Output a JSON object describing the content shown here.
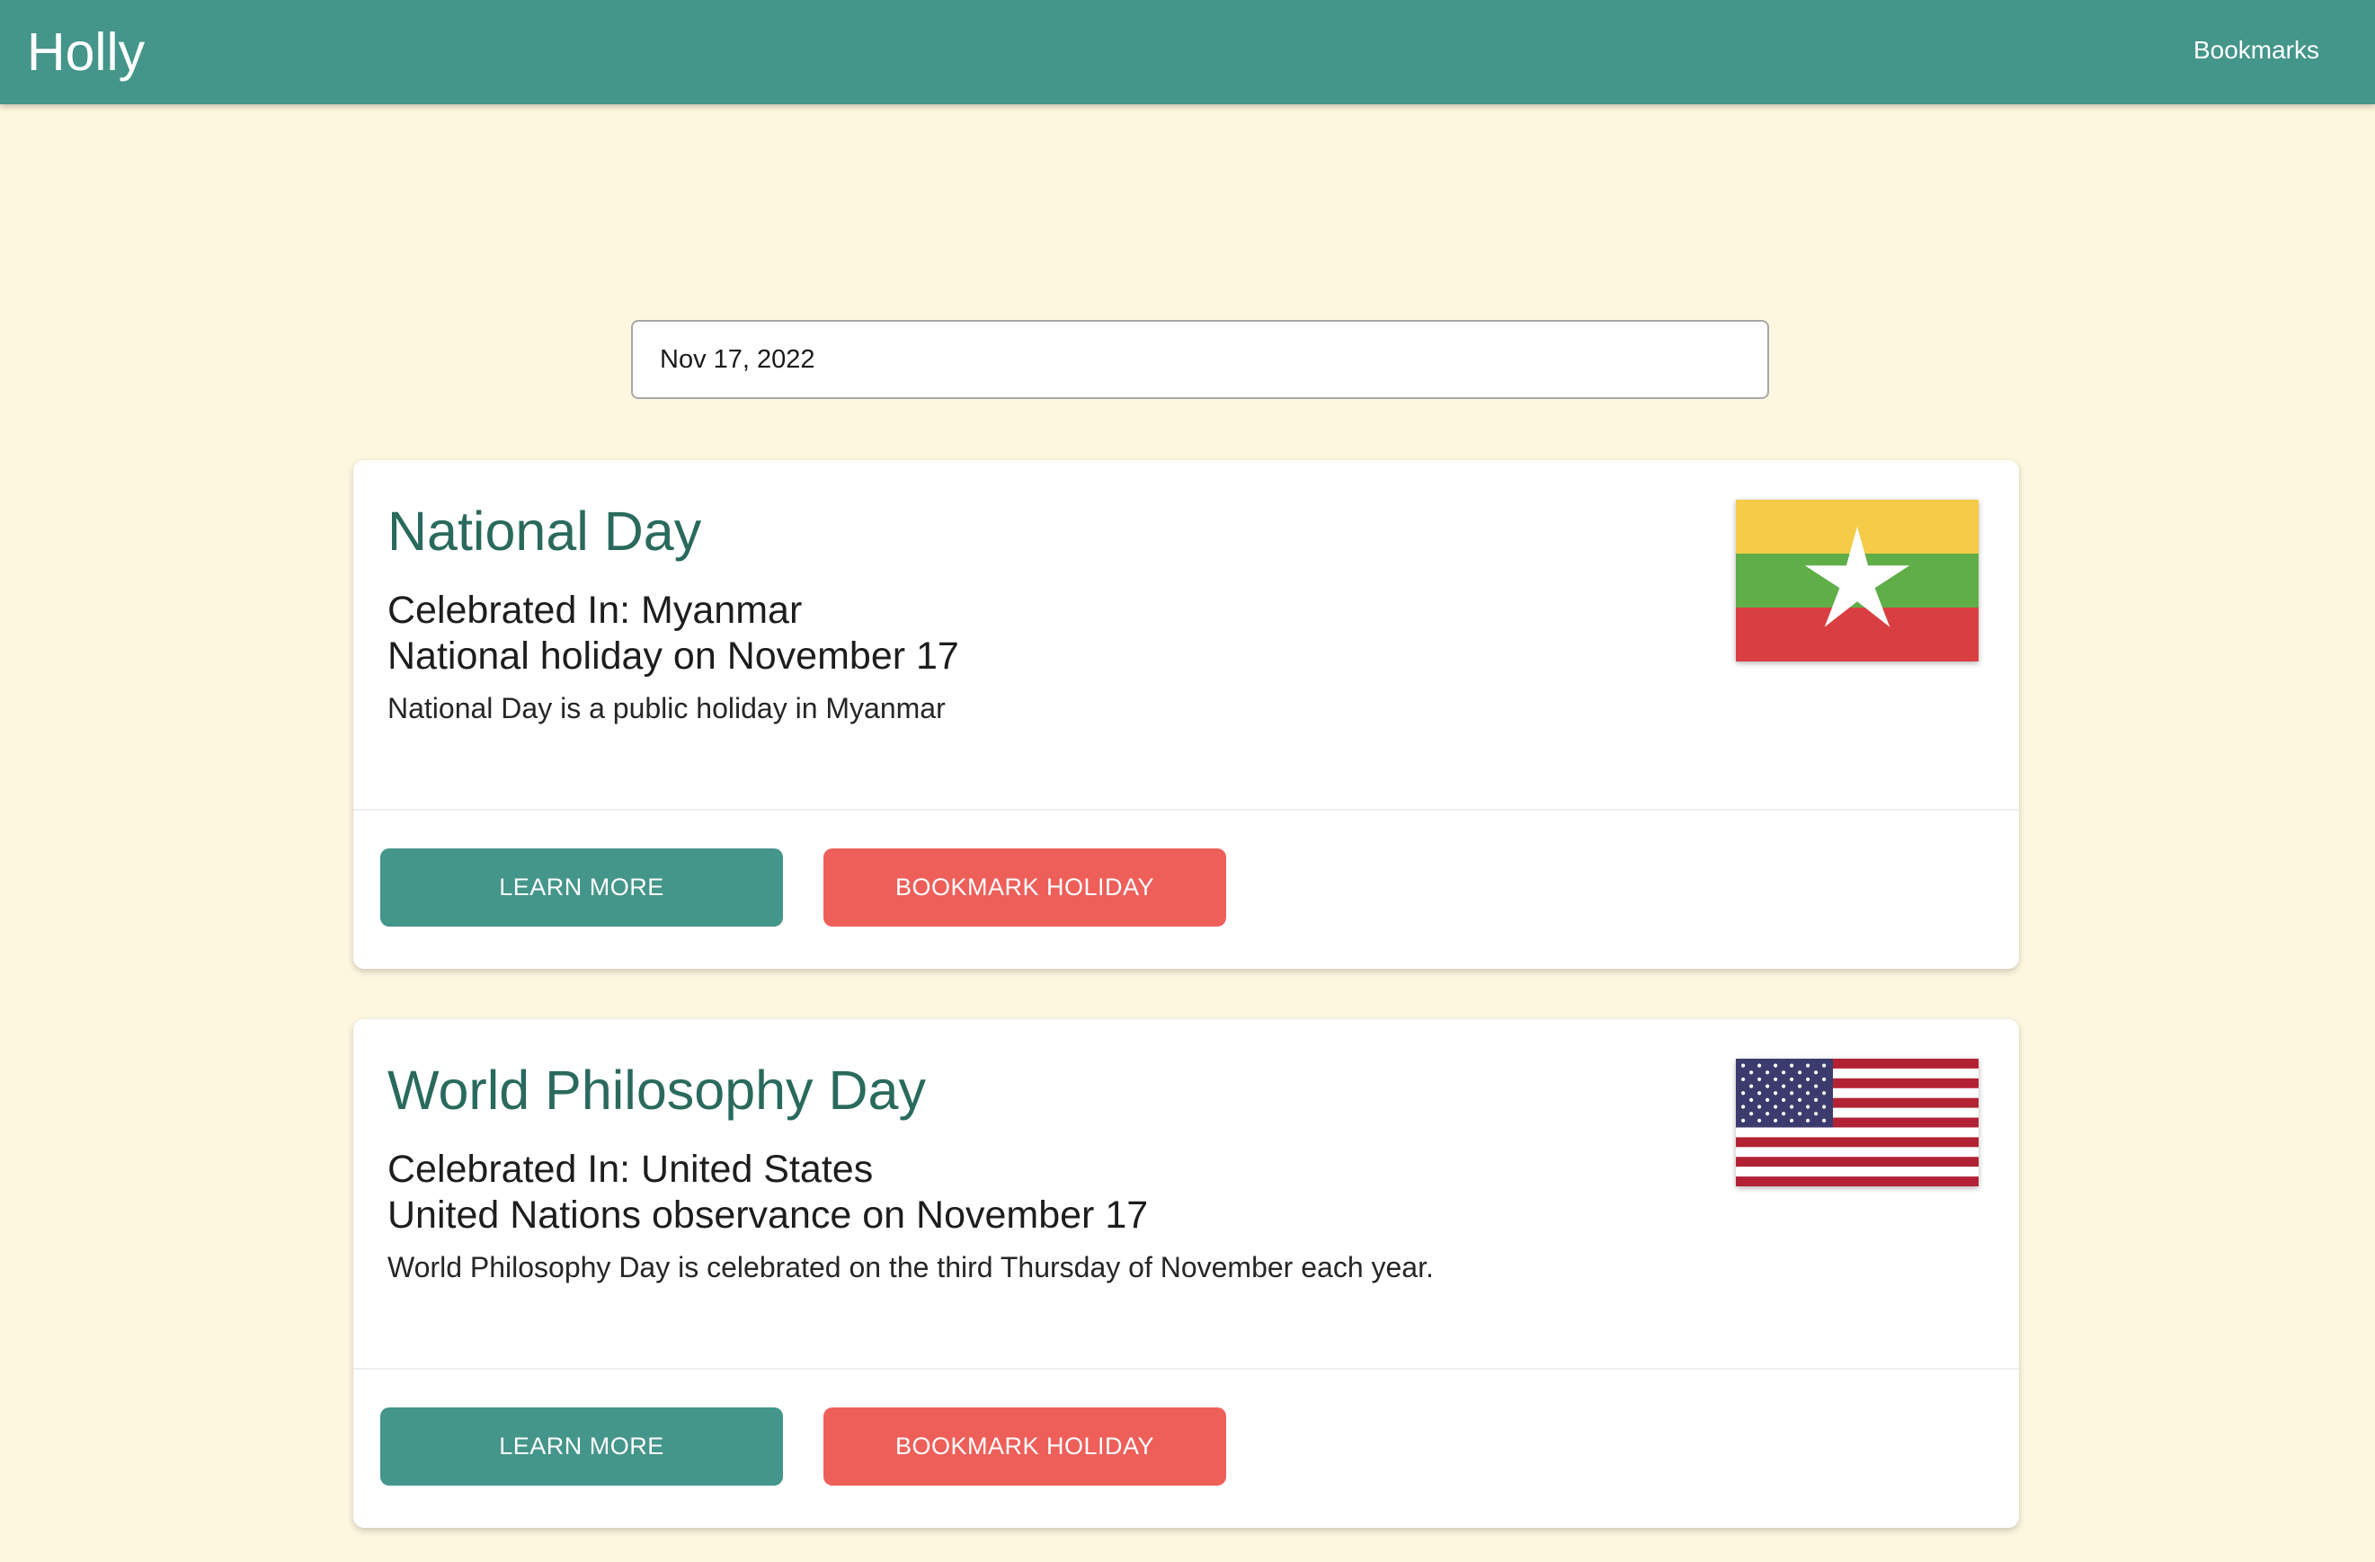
{
  "navbar": {
    "brand": "Holly",
    "bookmarks_link": "Bookmarks"
  },
  "date_picker": {
    "value": "Nov 17, 2022"
  },
  "holidays": [
    {
      "title": "National Day",
      "celebrated_in": "Celebrated In: Myanmar",
      "type_line": "National holiday on November 17",
      "description": "National Day is a public holiday in Myanmar",
      "flag_icon": "myanmar-flag-icon",
      "learn_more_label": "LEARN MORE",
      "bookmark_label": "BOOKMARK HOLIDAY"
    },
    {
      "title": "World Philosophy Day",
      "celebrated_in": "Celebrated In: United States",
      "type_line": "United Nations observance on November 17",
      "description": "World Philosophy Day is celebrated on the third Thursday of November each year.",
      "flag_icon": "united-states-flag-icon",
      "learn_more_label": "LEARN MORE",
      "bookmark_label": "BOOKMARK HOLIDAY"
    }
  ],
  "colors": {
    "page_background": "#fef7e0",
    "navbar": "#44958a",
    "title_text": "#296a5c",
    "learn_more_button": "#44958a",
    "bookmark_button": "#ee5f5a"
  }
}
